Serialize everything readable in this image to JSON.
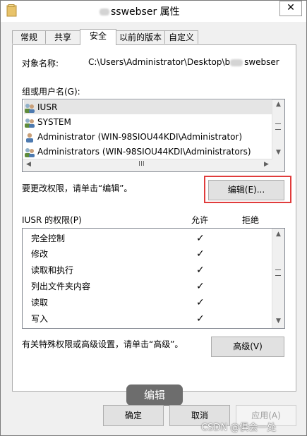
{
  "window": {
    "title": "sswebser 属性",
    "close_glyph": "✕",
    "folder_icon": "folder-icon"
  },
  "tabs": [
    {
      "label": "常规"
    },
    {
      "label": "共享"
    },
    {
      "label": "安全"
    },
    {
      "label": "以前的版本"
    },
    {
      "label": "自定义"
    }
  ],
  "active_tab": "安全",
  "object_name": {
    "label": "对象名称:",
    "value_prefix": "C:\\Users\\Administrator\\Desktop\\b",
    "value_suffix": "swebser"
  },
  "groups": {
    "label": "组或用户名(G):",
    "items": [
      {
        "name": "IUSR",
        "icon": "users-group-icon",
        "selected": true
      },
      {
        "name": "SYSTEM",
        "icon": "users-group-icon",
        "selected": false
      },
      {
        "name": "Administrator (WIN-98SIOU44KDI\\Administrator)",
        "icon": "user-icon",
        "selected": false
      },
      {
        "name": "Administrators (WIN-98SIOU44KDI\\Administrators)",
        "icon": "users-group-icon",
        "selected": false
      }
    ],
    "hscroll_grip": "III"
  },
  "change_hint": "要更改权限，请单击“编辑”。",
  "edit_button": "编辑(E)...",
  "permissions": {
    "label": "IUSR 的权限(P)",
    "allow_header": "允许",
    "deny_header": "拒绝",
    "rows": [
      {
        "name": "完全控制",
        "allow": "✓",
        "deny": ""
      },
      {
        "name": "修改",
        "allow": "✓",
        "deny": ""
      },
      {
        "name": "读取和执行",
        "allow": "✓",
        "deny": ""
      },
      {
        "name": "列出文件夹内容",
        "allow": "✓",
        "deny": ""
      },
      {
        "name": "读取",
        "allow": "✓",
        "deny": ""
      },
      {
        "name": "写入",
        "allow": "✓",
        "deny": ""
      }
    ]
  },
  "advanced_hint": "有关特殊权限或高级设置，请单击“高级”。",
  "advanced_button": "高级(V)",
  "footer": {
    "ok": "确定",
    "cancel": "取消",
    "apply": "应用(A)"
  },
  "tooltip": "编辑",
  "watermark": "CSDN @俱会一处",
  "colors": {
    "highlight_border": "#e03c3c",
    "panel_bg": "#ffffff",
    "window_bg": "#f0f0f0",
    "tooltip_bg": "#6d6d6d"
  }
}
